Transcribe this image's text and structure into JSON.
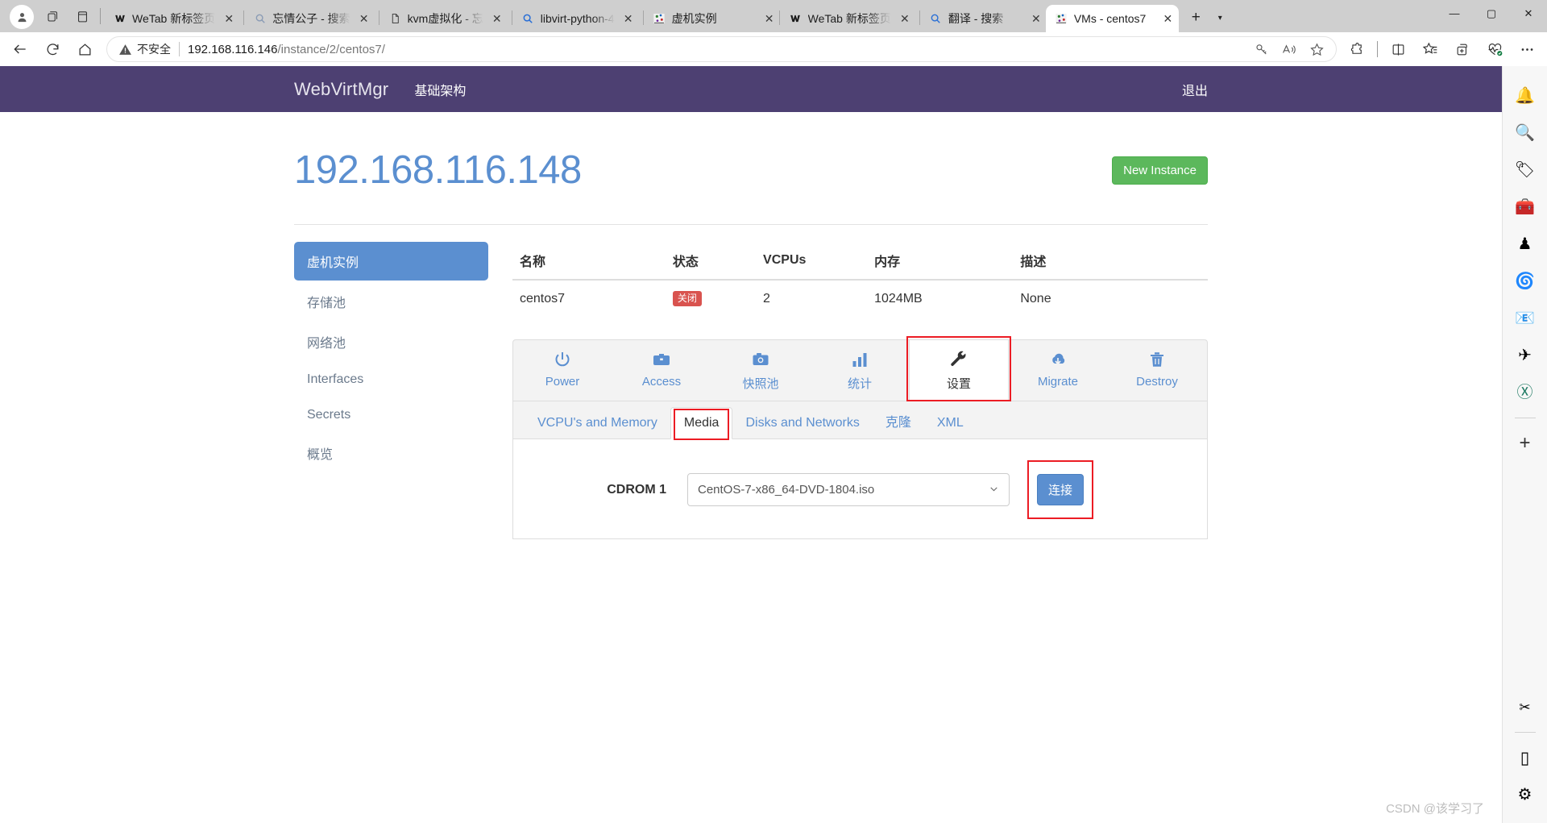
{
  "browser": {
    "tabs": [
      {
        "title": "WeTab 新标签页",
        "favicon": "wetab-icon",
        "active": false
      },
      {
        "title": "忘情公子 - 搜索",
        "favicon": "search-icon",
        "active": false
      },
      {
        "title": "kvm虚拟化 - 忘",
        "favicon": "page-icon",
        "active": false
      },
      {
        "title": "libvirt-python-4",
        "favicon": "search-blue-icon",
        "active": false
      },
      {
        "title": "虚机实例",
        "favicon": "webvirtmgr-icon",
        "active": false
      },
      {
        "title": "WeTab 新标签页",
        "favicon": "wetab-icon",
        "active": false
      },
      {
        "title": "翻译 - 搜索",
        "favicon": "search-icon",
        "active": false
      },
      {
        "title": "VMs - centos7",
        "favicon": "webvirtmgr-icon",
        "active": true
      }
    ],
    "tab_close_label": "✕",
    "new_tab_label": "+",
    "tab_menu_label": "▾",
    "window_controls": {
      "minimize": "—",
      "maximize": "▢",
      "close": "✕"
    },
    "toolbar": {
      "back": "back-arrow",
      "refresh": "refresh",
      "home": "home",
      "security_text": "不安全",
      "url_host": "192.168.116.146",
      "url_path": "/instance/2/centos7/",
      "icons": [
        "key-icon",
        "read-aloud-icon",
        "favorite-star-icon"
      ],
      "right_icons": [
        "extensions-icon",
        "split-screen-icon",
        "favorites-icon",
        "collections-icon",
        "browser-essentials-icon",
        "settings-more-icon"
      ]
    }
  },
  "edgebar": {
    "items": [
      {
        "name": "copilot-bell-icon",
        "glyph": "🔔"
      },
      {
        "name": "search-icon",
        "glyph": "🔍"
      },
      {
        "name": "shopping-tag-icon",
        "glyph": "🏷"
      },
      {
        "name": "toolbox-icon",
        "glyph": "🧰"
      },
      {
        "name": "games-icon",
        "glyph": "♟"
      },
      {
        "name": "microsoft365-icon",
        "glyph": "🌀"
      },
      {
        "name": "outlook-icon",
        "glyph": "📧"
      },
      {
        "name": "telegram-icon",
        "glyph": "✈"
      },
      {
        "name": "xmind-icon",
        "glyph": "Ⓧ"
      },
      {
        "name": "add-app-icon",
        "glyph": "+"
      }
    ],
    "bottom_items": [
      {
        "name": "screenshot-snip-icon",
        "glyph": "✂"
      },
      {
        "name": "sidebar-toggle-icon",
        "glyph": "▯"
      },
      {
        "name": "sidebar-settings-icon",
        "glyph": "⚙"
      }
    ]
  },
  "app": {
    "brand": "WebVirtMgr",
    "nav_link": "基础架构",
    "logout": "退出",
    "page_title": "192.168.116.148",
    "new_instance_label": "New Instance"
  },
  "sidebar": {
    "items": [
      {
        "label": "虚机实例",
        "active": true
      },
      {
        "label": "存储池",
        "active": false
      },
      {
        "label": "网络池",
        "active": false
      },
      {
        "label": "Interfaces",
        "active": false
      },
      {
        "label": "Secrets",
        "active": false
      },
      {
        "label": "概览",
        "active": false
      }
    ]
  },
  "instance_table": {
    "headers": [
      "名称",
      "状态",
      "VCPUs",
      "内存",
      "描述"
    ],
    "row": {
      "name": "centos7",
      "state": "关闭",
      "vcpus": "2",
      "memory": "1024MB",
      "description": "None"
    }
  },
  "action_tabs": [
    {
      "label": "Power",
      "icon": "power-icon",
      "active": false
    },
    {
      "label": "Access",
      "icon": "access-icon",
      "active": false
    },
    {
      "label": "快照池",
      "icon": "snapshot-icon",
      "active": false
    },
    {
      "label": "统计",
      "icon": "stats-icon",
      "active": false
    },
    {
      "label": "设置",
      "icon": "wrench-icon",
      "active": true
    },
    {
      "label": "Migrate",
      "icon": "migrate-icon",
      "active": false
    },
    {
      "label": "Destroy",
      "icon": "trash-icon",
      "active": false
    }
  ],
  "settings_tabs": [
    {
      "label": "VCPU's and Memory",
      "active": false
    },
    {
      "label": "Media",
      "active": true
    },
    {
      "label": "Disks and Networks",
      "active": false
    },
    {
      "label": "克隆",
      "active": false
    },
    {
      "label": "XML",
      "active": false
    }
  ],
  "media": {
    "cdrom_label": "CDROM 1",
    "selected_iso": "CentOS-7-x86_64-DVD-1804.iso",
    "connect_label": "连接",
    "caret": "⌄"
  },
  "watermark": "CSDN @该学习了",
  "colors": {
    "navbar": "#4d4072",
    "title_blue": "#5b8fd0",
    "new_instance_green": "#5cb85c",
    "badge_red": "#d9534f",
    "highlight_red": "#ec1c24"
  }
}
